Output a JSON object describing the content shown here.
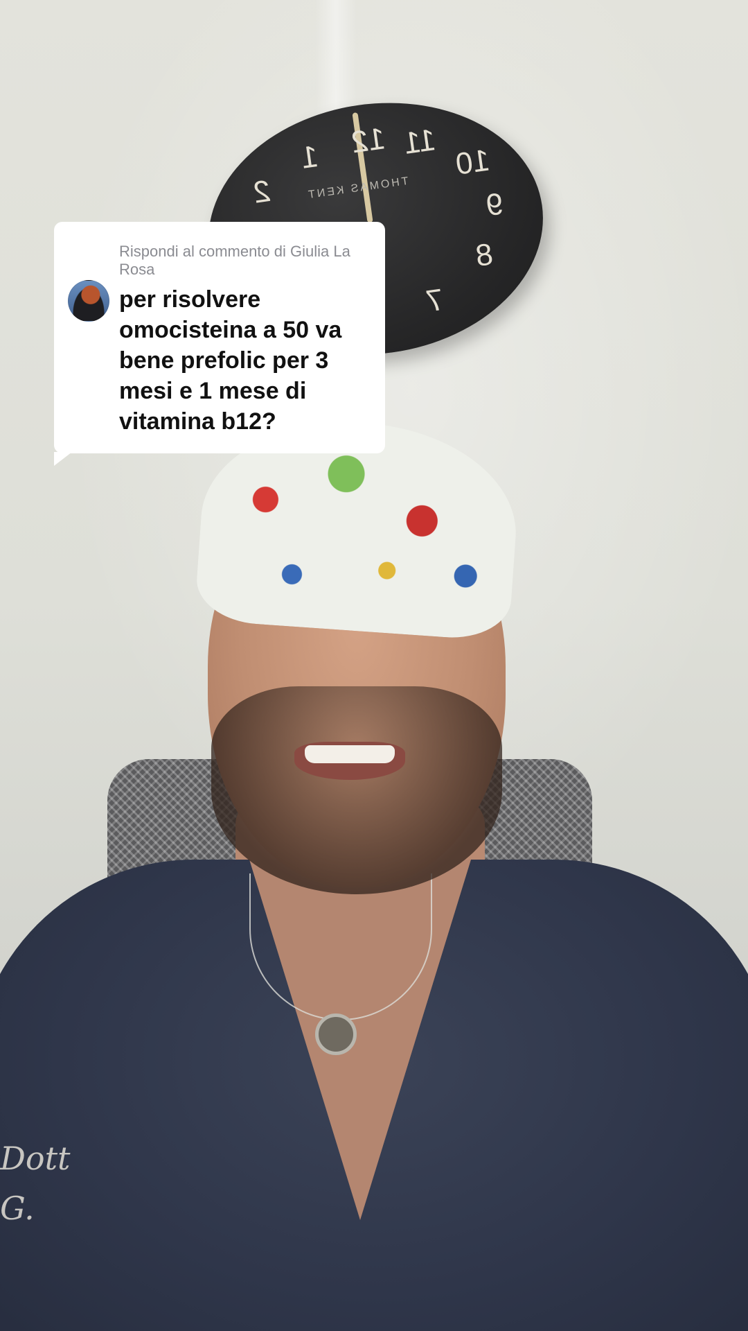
{
  "reply_sticker": {
    "header": "Rispondi al commento di Giulia La Rosa",
    "comment": "per risolvere omocisteina a 50 va bene prefolic per 3 mesi e 1 mese di vitamina b12?",
    "avatar_icon": "commenter-avatar"
  },
  "video_scene": {
    "clock_brand": "THOMAS KENT",
    "clock_numbers": [
      "12",
      "11",
      "10",
      "9",
      "8",
      "7",
      "1",
      "2"
    ],
    "shirt_embroidery": [
      "Dott",
      "G. "
    ]
  },
  "colors": {
    "card_background": "#ffffff",
    "header_text": "#8a8b91",
    "comment_text": "#111111"
  }
}
